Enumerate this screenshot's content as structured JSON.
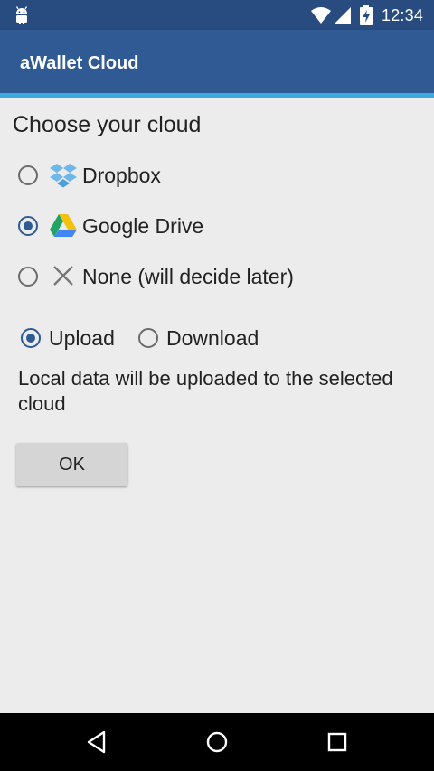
{
  "status_bar": {
    "time": "12:34",
    "icons": [
      "android-icon",
      "wifi-icon",
      "signal-icon",
      "battery-charging-icon"
    ]
  },
  "app_bar": {
    "title": "aWallet Cloud"
  },
  "main": {
    "heading": "Choose your cloud",
    "cloud_options": [
      {
        "label": "Dropbox",
        "icon": "dropbox-icon",
        "checked": false
      },
      {
        "label": "Google Drive",
        "icon": "google-drive-icon",
        "checked": true
      },
      {
        "label": "None (will decide later)",
        "icon": "close-icon",
        "checked": false
      }
    ],
    "direction_options": [
      {
        "label": "Upload",
        "checked": true
      },
      {
        "label": "Download",
        "checked": false
      }
    ],
    "info_text": "Local data will be uploaded to the selected cloud",
    "ok_label": "OK"
  },
  "nav_bar": {
    "icons": [
      "back-icon",
      "home-icon",
      "recents-icon"
    ]
  },
  "colors": {
    "status_bar": "#284b80",
    "app_bar": "#2f5a93",
    "accent_line": "#3fa9e0",
    "background": "#ececec",
    "radio_checked": "#2f5a93"
  }
}
